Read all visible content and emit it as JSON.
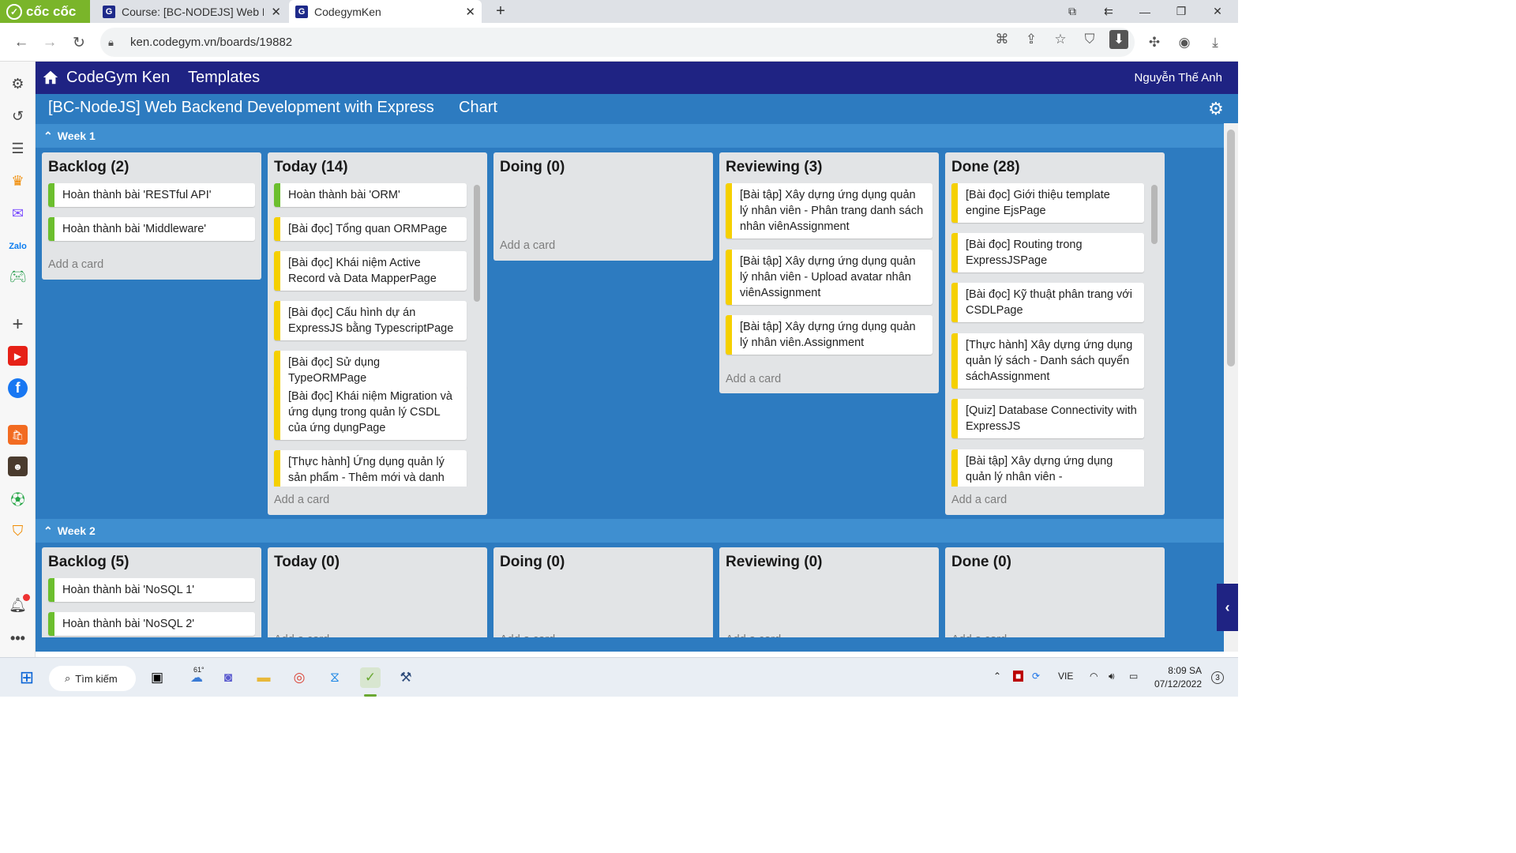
{
  "browser": {
    "brand": "cốc cốc",
    "tabs": [
      {
        "title": "Course: [BC-NODEJS] Web B",
        "active": false
      },
      {
        "title": "CodegymKen",
        "active": true
      }
    ],
    "url": "ken.codegym.vn/boards/19882"
  },
  "app": {
    "brand": "CodeGym Ken",
    "templates": "Templates",
    "user": "Nguyễn Thế Anh"
  },
  "board": {
    "title": "[BC-NodeJS] Web Backend Development with Express",
    "chart_link": "Chart",
    "weeks": [
      {
        "label": "Week 1",
        "columns": [
          {
            "title": "Backlog (2)",
            "cards": [
              {
                "text": "Hoàn thành bài 'RESTful API'",
                "color": "green"
              },
              {
                "text": "Hoàn thành bài 'Middleware'",
                "color": "green"
              }
            ],
            "add": "Add a card"
          },
          {
            "title": "Today (14)",
            "cards": [
              {
                "text": "Hoàn thành bài 'ORM'",
                "color": "green"
              },
              {
                "text": "[Bài đọc] Tổng quan ORMPage",
                "color": "yellow"
              },
              {
                "text": "[Bài đọc] Khái niệm Active Record và Data MapperPage",
                "color": "yellow"
              },
              {
                "text": "[Bài đọc] Cấu hình dự án ExpressJS bằng TypescriptPage",
                "color": "yellow"
              },
              {
                "text": "[Bài đọc] Sử dụng TypeORMPage",
                "color": "yellow"
              },
              {
                "text": "[Bài đọc] Khái niệm Migration và ứng dụng trong quản lý CSDL của ứng dụngPage",
                "color": "yellow"
              },
              {
                "text": "[Thực hành] Ứng dụng quản lý sản phẩm - Thêm mới và danh",
                "color": "yellow"
              }
            ],
            "add": "Add a card"
          },
          {
            "title": "Doing (0)",
            "cards": [],
            "add": "Add a card"
          },
          {
            "title": "Reviewing (3)",
            "cards": [
              {
                "text": "[Bài tập] Xây dựng ứng dụng quản lý nhân viên - Phân trang danh sách nhân viênAssignment",
                "color": "yellow"
              },
              {
                "text": "[Bài tập] Xây dựng ứng dụng quản lý nhân viên - Upload avatar nhân viênAssignment",
                "color": "yellow"
              },
              {
                "text": "[Bài tập] Xây dựng ứng dụng quản lý nhân viên.Assignment",
                "color": "yellow"
              }
            ],
            "add": "Add a card"
          },
          {
            "title": "Done (28)",
            "cards": [
              {
                "text": "[Bài đọc] Giới thiệu template engine EjsPage",
                "color": "yellow"
              },
              {
                "text": "[Bài đọc] Routing trong ExpressJSPage",
                "color": "yellow"
              },
              {
                "text": "[Bài đọc] Kỹ thuật phân trang với CSDLPage",
                "color": "yellow"
              },
              {
                "text": "[Thực hành] Xây dựng ứng dụng quản lý sách - Danh sách quyển sáchAssignment",
                "color": "yellow"
              },
              {
                "text": "[Quiz] Database Connectivity with ExpressJS",
                "color": "yellow"
              },
              {
                "text": "[Bài tập] Xây dựng ứng dụng quản lý nhân viên -",
                "color": "yellow"
              }
            ],
            "add": "Add a card"
          }
        ]
      },
      {
        "label": "Week 2",
        "columns": [
          {
            "title": "Backlog (5)",
            "cards": [
              {
                "text": "Hoàn thành bài 'NoSQL 1'",
                "color": "green"
              },
              {
                "text": "Hoàn thành bài 'NoSQL 2'",
                "color": "green"
              }
            ]
          },
          {
            "title": "Today (0)",
            "cards": [],
            "add": "Add a card"
          },
          {
            "title": "Doing (0)",
            "cards": [],
            "add": "Add a card"
          },
          {
            "title": "Reviewing (0)",
            "cards": [],
            "add": "Add a card"
          },
          {
            "title": "Done (0)",
            "cards": [],
            "add": "Add a card"
          }
        ]
      }
    ]
  },
  "taskbar": {
    "search": "Tìm kiếm",
    "weather": "61°",
    "lang": "VIE",
    "time": "8:09 SA",
    "date": "07/12/2022",
    "notifications": "3"
  },
  "colors": {
    "header": "#1f2383",
    "board": "#2d7bc0",
    "green": "#6cbf2e",
    "yellow": "#f5d000"
  }
}
